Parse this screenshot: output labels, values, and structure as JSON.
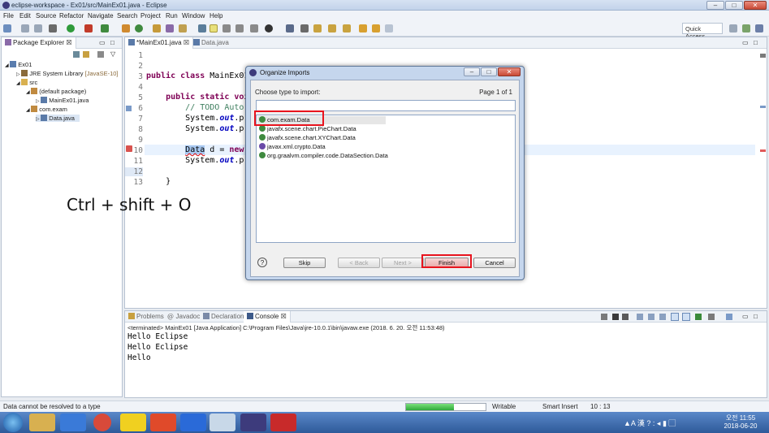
{
  "window": {
    "title": "eclipse-workspace - Ex01/src/MainEx01.java - Eclipse"
  },
  "menu": [
    "File",
    "Edit",
    "Source",
    "Refactor",
    "Navigate",
    "Search",
    "Project",
    "Run",
    "Window",
    "Help"
  ],
  "toolbar": {
    "quick_access": "Quick Access"
  },
  "package_explorer": {
    "tab_label": "Package Explorer",
    "tree": [
      {
        "label": "Ex01"
      },
      {
        "label": "JRE System Library",
        "suffix": "[JavaSE-10]"
      },
      {
        "label": "src"
      },
      {
        "label": "(default package)"
      },
      {
        "label": "MainEx01.java"
      },
      {
        "label": "com.exam"
      },
      {
        "label": "Data.java"
      }
    ]
  },
  "editor": {
    "tabs": [
      "*MainEx01.java",
      "Data.java"
    ],
    "line_numbers": [
      "1",
      "2",
      "3",
      "4",
      "5",
      "6",
      "7",
      "8",
      "9",
      "10",
      "11",
      "12",
      "13"
    ]
  },
  "overlay_text": "Ctrl + shift + O",
  "dialog": {
    "title": "Organize Imports",
    "prompt": "Choose type to import:",
    "page": "Page 1 of 1",
    "filter_value": "",
    "options": [
      "com.exam.Data",
      "javafx.scene.chart.PieChart.Data",
      "javafx.scene.chart.XYChart.Data",
      "javax.xml.crypto.Data",
      "org.graalvm.compiler.code.DataSection.Data"
    ],
    "buttons": {
      "skip": "Skip",
      "back": "< Back",
      "next": "Next >",
      "finish": "Finish",
      "cancel": "Cancel"
    }
  },
  "bottom_panel": {
    "tabs": [
      "Problems",
      "Javadoc",
      "Declaration",
      "Console"
    ],
    "terminated": "<terminated> MainEx01 [Java Application] C:\\Program Files\\Java\\jre-10.0.1\\bin\\javaw.exe (2018. 6. 20. 오전 11:53:48)",
    "output": [
      "Hello Eclipse",
      "Hello Eclipse",
      "Hello"
    ]
  },
  "status": {
    "message": "Data cannot be resolved to a type",
    "writable": "Writable",
    "insert_mode": "Smart Insert",
    "position": "10 : 13",
    "progress": 0.6
  },
  "taskbar": {
    "time": "오전 11:55",
    "date": "2018-06-20"
  },
  "colors": {
    "selection_red": "#e8141e",
    "keyword": "#7f0055",
    "comment": "#3f7f5f",
    "field": "#0000c0"
  }
}
